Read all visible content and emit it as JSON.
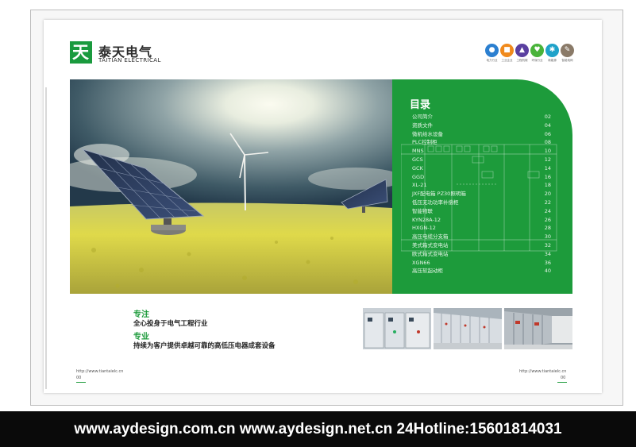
{
  "brand": {
    "logo_mark": "天",
    "name_cn": "泰天电气",
    "name_en": "TAITIAN ELECTRICAL",
    "color": "#1d9b3b"
  },
  "industry_icons": [
    {
      "icon": "lightbulb-icon",
      "color": "#2b7fd0",
      "caption": "电力行业"
    },
    {
      "icon": "factory-icon",
      "color": "#f08a1c",
      "caption": "工业企业"
    },
    {
      "icon": "building-icon",
      "color": "#5a3fa0",
      "caption": "工程机械"
    },
    {
      "icon": "leaf-icon",
      "color": "#49b33a",
      "caption": "环保行业"
    },
    {
      "icon": "wind-turbine-icon",
      "color": "#1fa2c9",
      "caption": "新能源"
    },
    {
      "icon": "pencil-icon",
      "color": "#8a7a68",
      "caption": "智能电网"
    }
  ],
  "toc": {
    "title": "目录",
    "items": [
      {
        "label": "公司简介",
        "page": "02"
      },
      {
        "label": "资质文件",
        "page": "04"
      },
      {
        "label": "微机给水设备",
        "page": "06"
      },
      {
        "label": "PLC控制柜",
        "page": "08"
      },
      {
        "label": "MNS",
        "page": "10"
      },
      {
        "label": "GCS",
        "page": "12"
      },
      {
        "label": "GCK",
        "page": "14"
      },
      {
        "label": "GGD",
        "page": "16"
      },
      {
        "label": "XL-21",
        "page": "18"
      },
      {
        "label": "JXF配电箱  PZ30照明箱",
        "page": "20"
      },
      {
        "label": "低压无功功率补偿柜",
        "page": "22"
      },
      {
        "label": "智能物联",
        "page": "24"
      },
      {
        "label": "KYN28A-12",
        "page": "26"
      },
      {
        "label": "HXGN-12",
        "page": "28"
      },
      {
        "label": "高压电缆分支箱",
        "page": "30"
      },
      {
        "label": "美式箱式变电站",
        "page": "32"
      },
      {
        "label": "欧式箱式变电站",
        "page": "34"
      },
      {
        "label": "XGN66",
        "page": "36"
      },
      {
        "label": "高压软起动柜",
        "page": "40"
      }
    ]
  },
  "taglines": {
    "head1": "专注",
    "line1": "全心投身于电气工程行业",
    "head2": "专业",
    "line2": "持续为客户提供卓越可靠的高低压电器成套设备"
  },
  "footer": {
    "left_url": "http://www.tiantaielc.cn",
    "left_page": "00",
    "right_url": "http://www.tiantaielc.cn",
    "right_page": "00"
  },
  "banner": {
    "text": "www.aydesign.com.cn www.aydesign.net.cn 24Hotline:15601814031"
  }
}
